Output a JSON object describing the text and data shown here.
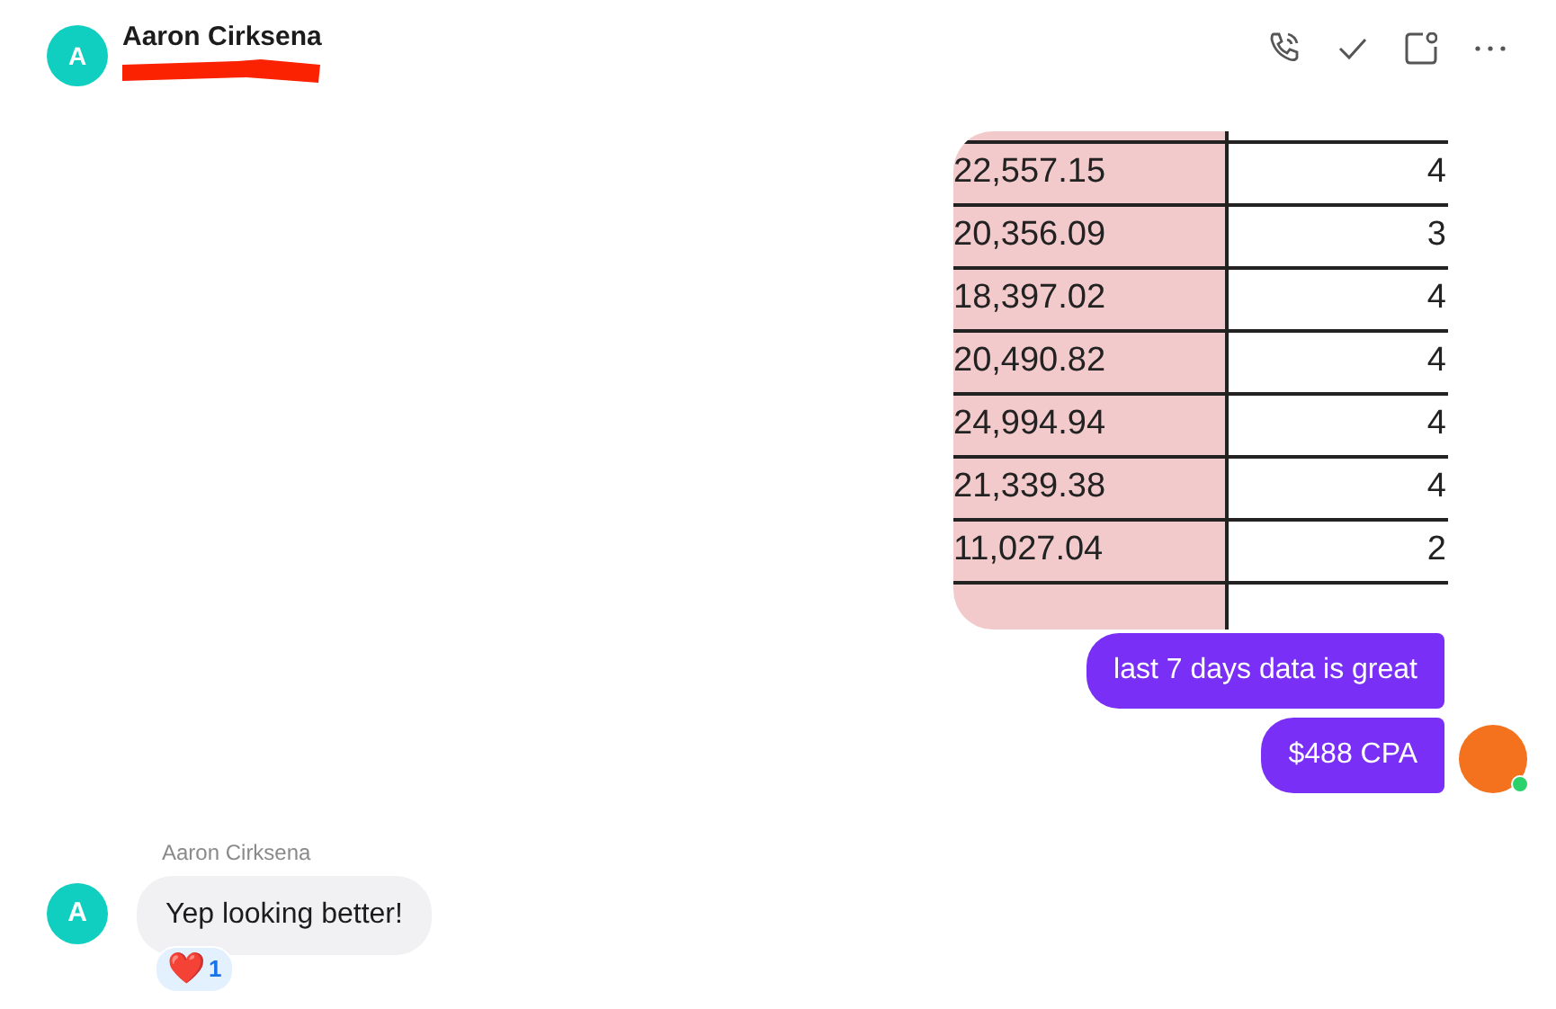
{
  "header": {
    "avatar_initial": "A",
    "name": "Aaron Cirksena",
    "redacted": true
  },
  "messages": [
    {
      "kind": "image",
      "rows": [
        {
          "column_1": "22,557.15",
          "column_2": "4"
        },
        {
          "column_1": "20,356.09",
          "column_2": "3"
        },
        {
          "column_1": "18,397.02",
          "column_2": "4"
        },
        {
          "column_1": "20,490.82",
          "column_2": "4"
        },
        {
          "column_1": "24,994.94",
          "column_2": "4"
        },
        {
          "column_1": "21,339.38",
          "column_2": "4"
        },
        {
          "column_1": "11,027.04",
          "column_2": "2"
        }
      ]
    },
    {
      "kind": "outgoing",
      "text": "last 7 days data is great"
    },
    {
      "kind": "outgoing",
      "text": "$488 CPA",
      "avatar": true,
      "online": true
    },
    {
      "kind": "incoming",
      "sender": "Aaron Cirksena",
      "avatar_initial": "A",
      "text": "Yep looking better!",
      "reactions": [
        {
          "emoji": "❤️",
          "count": "1"
        }
      ]
    }
  ]
}
